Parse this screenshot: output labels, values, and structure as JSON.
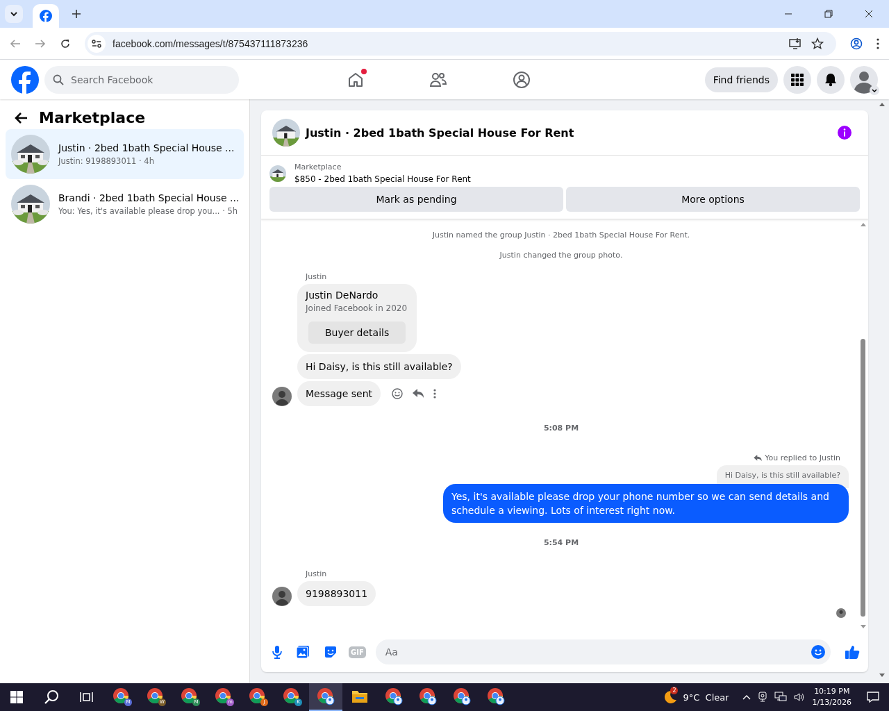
{
  "browser": {
    "url": "facebook.com/messages/t/875437111873236"
  },
  "header": {
    "search_placeholder": "Search Facebook",
    "find_friends": "Find friends",
    "home_notification": true
  },
  "sidebar": {
    "title": "Marketplace",
    "conversations": [
      {
        "title": "Justin · 2bed 1bath Special House ...",
        "preview": "Justin: 9198893011 · 4h",
        "selected": true
      },
      {
        "title": "Brandi · 2bed 1bath Special House ...",
        "preview": "You: Yes, it's available please drop you... · 5h",
        "selected": false
      }
    ]
  },
  "chat": {
    "title": "Justin · 2bed 1bath Special House For Rent",
    "listing": {
      "source": "Marketplace",
      "title": "$850 - 2bed 1bath Special House For Rent"
    },
    "actions": [
      "Mark as pending",
      "More options"
    ],
    "messages": [
      {
        "kind": "system",
        "text": "Justin named the group Justin · 2bed 1bath Special House For Rent."
      },
      {
        "kind": "system",
        "text": "Justin changed the group photo."
      },
      {
        "kind": "sender",
        "text": "Justin"
      },
      {
        "kind": "profile",
        "name": "Justin DeNardo",
        "detail": "Joined Facebook in 2020",
        "button": "Buyer details"
      },
      {
        "kind": "incoming",
        "text": "Hi Daisy, is this still available?",
        "avatar": false,
        "hovered": false
      },
      {
        "kind": "incoming",
        "text": "Message sent",
        "avatar": true,
        "hovered": true
      },
      {
        "kind": "time",
        "text": "5:08 PM"
      },
      {
        "kind": "reply_note",
        "text": "You replied to Justin"
      },
      {
        "kind": "quote",
        "text": "Hi Daisy, is this still available?"
      },
      {
        "kind": "outgoing",
        "text": "Yes, it's available please drop your phone number so we can send details and schedule a viewing. Lots of interest right now."
      },
      {
        "kind": "time",
        "text": "5:54 PM"
      },
      {
        "kind": "sender",
        "text": "Justin"
      },
      {
        "kind": "incoming",
        "text": "9198893011",
        "avatar": true,
        "hovered": false
      }
    ],
    "composer": {
      "placeholder": "Aa",
      "gif": "GIF"
    }
  },
  "taskbar": {
    "apps": [
      {
        "kind": "chrome",
        "badge": "M",
        "color": "#5b6fd6",
        "selected": false
      },
      {
        "kind": "chrome",
        "badge": "W",
        "color": "#7a5d2a",
        "selected": false
      },
      {
        "kind": "chrome",
        "badge": "M",
        "color": "#2e8b57",
        "selected": false
      },
      {
        "kind": "chrome",
        "badge": "m",
        "color": "#a05cc8",
        "selected": false
      },
      {
        "kind": "chrome",
        "badge": "J",
        "color": "#e06a1b",
        "selected": false
      },
      {
        "kind": "chrome",
        "badge": "K",
        "color": "#1f8fb8",
        "selected": false
      },
      {
        "kind": "chrome-profile",
        "selected": true
      },
      {
        "kind": "folder",
        "selected": false
      },
      {
        "kind": "chrome-profile",
        "selected": false
      },
      {
        "kind": "chrome-profile",
        "selected": false
      },
      {
        "kind": "chrome-profile",
        "selected": false
      },
      {
        "kind": "chrome-profile",
        "selected": false
      }
    ],
    "weather": {
      "badge": "2",
      "text": "9°C  Clear"
    },
    "time": "10:19 PM",
    "date": "1/13/2026"
  }
}
